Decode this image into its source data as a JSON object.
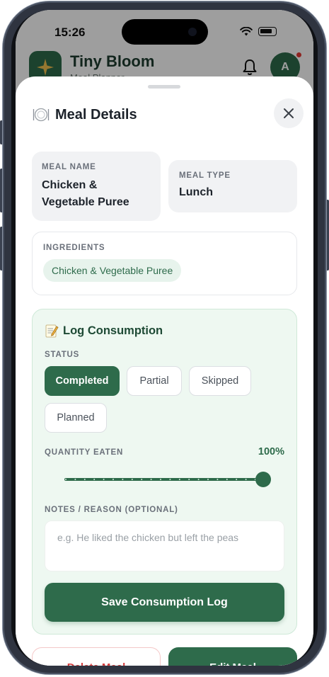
{
  "status_bar": {
    "time": "15:26"
  },
  "app": {
    "title": "Tiny Bloom",
    "subtitle": "Meal Planner",
    "avatar_initial": "A"
  },
  "icons": {
    "app_logo": "sparkle-icon",
    "notifications": "bell-icon",
    "close": "close-icon",
    "sheet_title": "plate-icon",
    "log_title": "memo-icon"
  },
  "sheet": {
    "title": "Meal Details",
    "meal_name_label": "MEAL NAME",
    "meal_name": "Chicken & Vegetable Puree",
    "meal_type_label": "MEAL TYPE",
    "meal_type": "Lunch",
    "ingredients_label": "INGREDIENTS",
    "ingredients": [
      "Chicken & Vegetable Puree"
    ]
  },
  "log": {
    "title": "Log Consumption",
    "status_label": "STATUS",
    "statuses": [
      {
        "label": "Completed",
        "selected": true
      },
      {
        "label": "Partial",
        "selected": false
      },
      {
        "label": "Skipped",
        "selected": false
      },
      {
        "label": "Planned",
        "selected": false
      }
    ],
    "quantity_label": "QUANTITY EATEN",
    "quantity_value": "100%",
    "quantity_fraction": 1.0,
    "notes_label": "NOTES / REASON (OPTIONAL)",
    "notes_value": "",
    "notes_placeholder": "e.g. He liked the chicken but left the peas",
    "save_label": "Save Consumption Log"
  },
  "actions": {
    "delete_label": "Delete Meal",
    "edit_label": "Edit Meal"
  },
  "colors": {
    "primary": "#2e6b4b",
    "danger": "#d33a3a",
    "log_background": "#eef8f1"
  }
}
